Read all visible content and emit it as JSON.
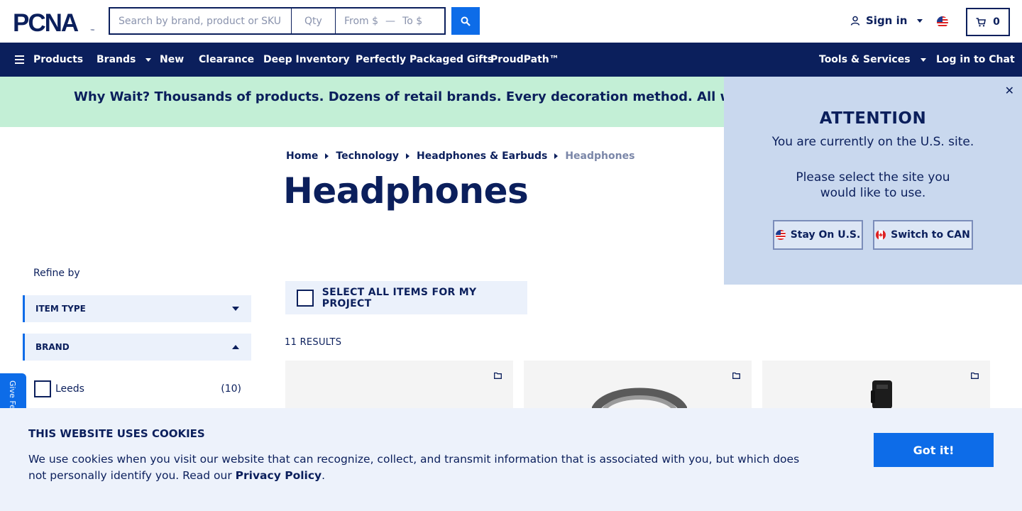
{
  "header": {
    "logo_text": "PCNA",
    "search_placeholder": "Search by brand, product or SKU",
    "qty_placeholder": "Qty",
    "price_from_placeholder": "From $",
    "price_to_placeholder": "To $",
    "price_separator": "—",
    "search_icon": "search-icon",
    "signin_label": "Sign in",
    "cart_count": "0"
  },
  "nav": {
    "products": "Products",
    "brands": "Brands",
    "new": "New",
    "clearance": "Clearance",
    "deep_inventory": "Deep Inventory",
    "gifts": "Perfectly Packaged Gifts",
    "proudpath": "ProudPath™",
    "tools": "Tools & Services",
    "chat": "Log in to Chat"
  },
  "promo": {
    "text": "Why Wait? Thousands of products. Dozens of retail brands. Every decoration method. All with a standard"
  },
  "breadcrumb": [
    "Home",
    "Technology",
    "Headphones & Earbuds",
    "Headphones"
  ],
  "page_title": "Headphones",
  "sidebar": {
    "refine_label": "Refine by",
    "facets": [
      {
        "label": "ITEM TYPE",
        "expanded": false
      },
      {
        "label": "BRAND",
        "expanded": true
      }
    ],
    "brand_options": [
      {
        "label": "Leeds",
        "count": "(10)"
      }
    ],
    "feedback_label": "Give Feedback"
  },
  "listing": {
    "select_all_label": "SELECT ALL ITEMS FOR MY PROJECT",
    "results_label": "11 RESULTS"
  },
  "popup": {
    "title": "ATTENTION",
    "line1": "You are currently on the U.S. site.",
    "line2": "Please select the site you",
    "line3": "would like to use.",
    "stay_label": "Stay On U.S.",
    "switch_label": "Switch to CAN",
    "close_glyph": "✕"
  },
  "cookie": {
    "title": "THIS WEBSITE USES COOKIES",
    "text": "We use cookies when you visit our website that can recognize, collect, and transmit information that is associated with you, but which does not personally identify you. Read our ",
    "link": "Privacy Policy",
    "suffix": ".",
    "button": "Got it!"
  },
  "colors": {
    "navy": "#0b1f5c",
    "accent_blue": "#0d6ce8",
    "promo_green": "#c3efd6",
    "popup_bg": "#c9d8ee"
  }
}
